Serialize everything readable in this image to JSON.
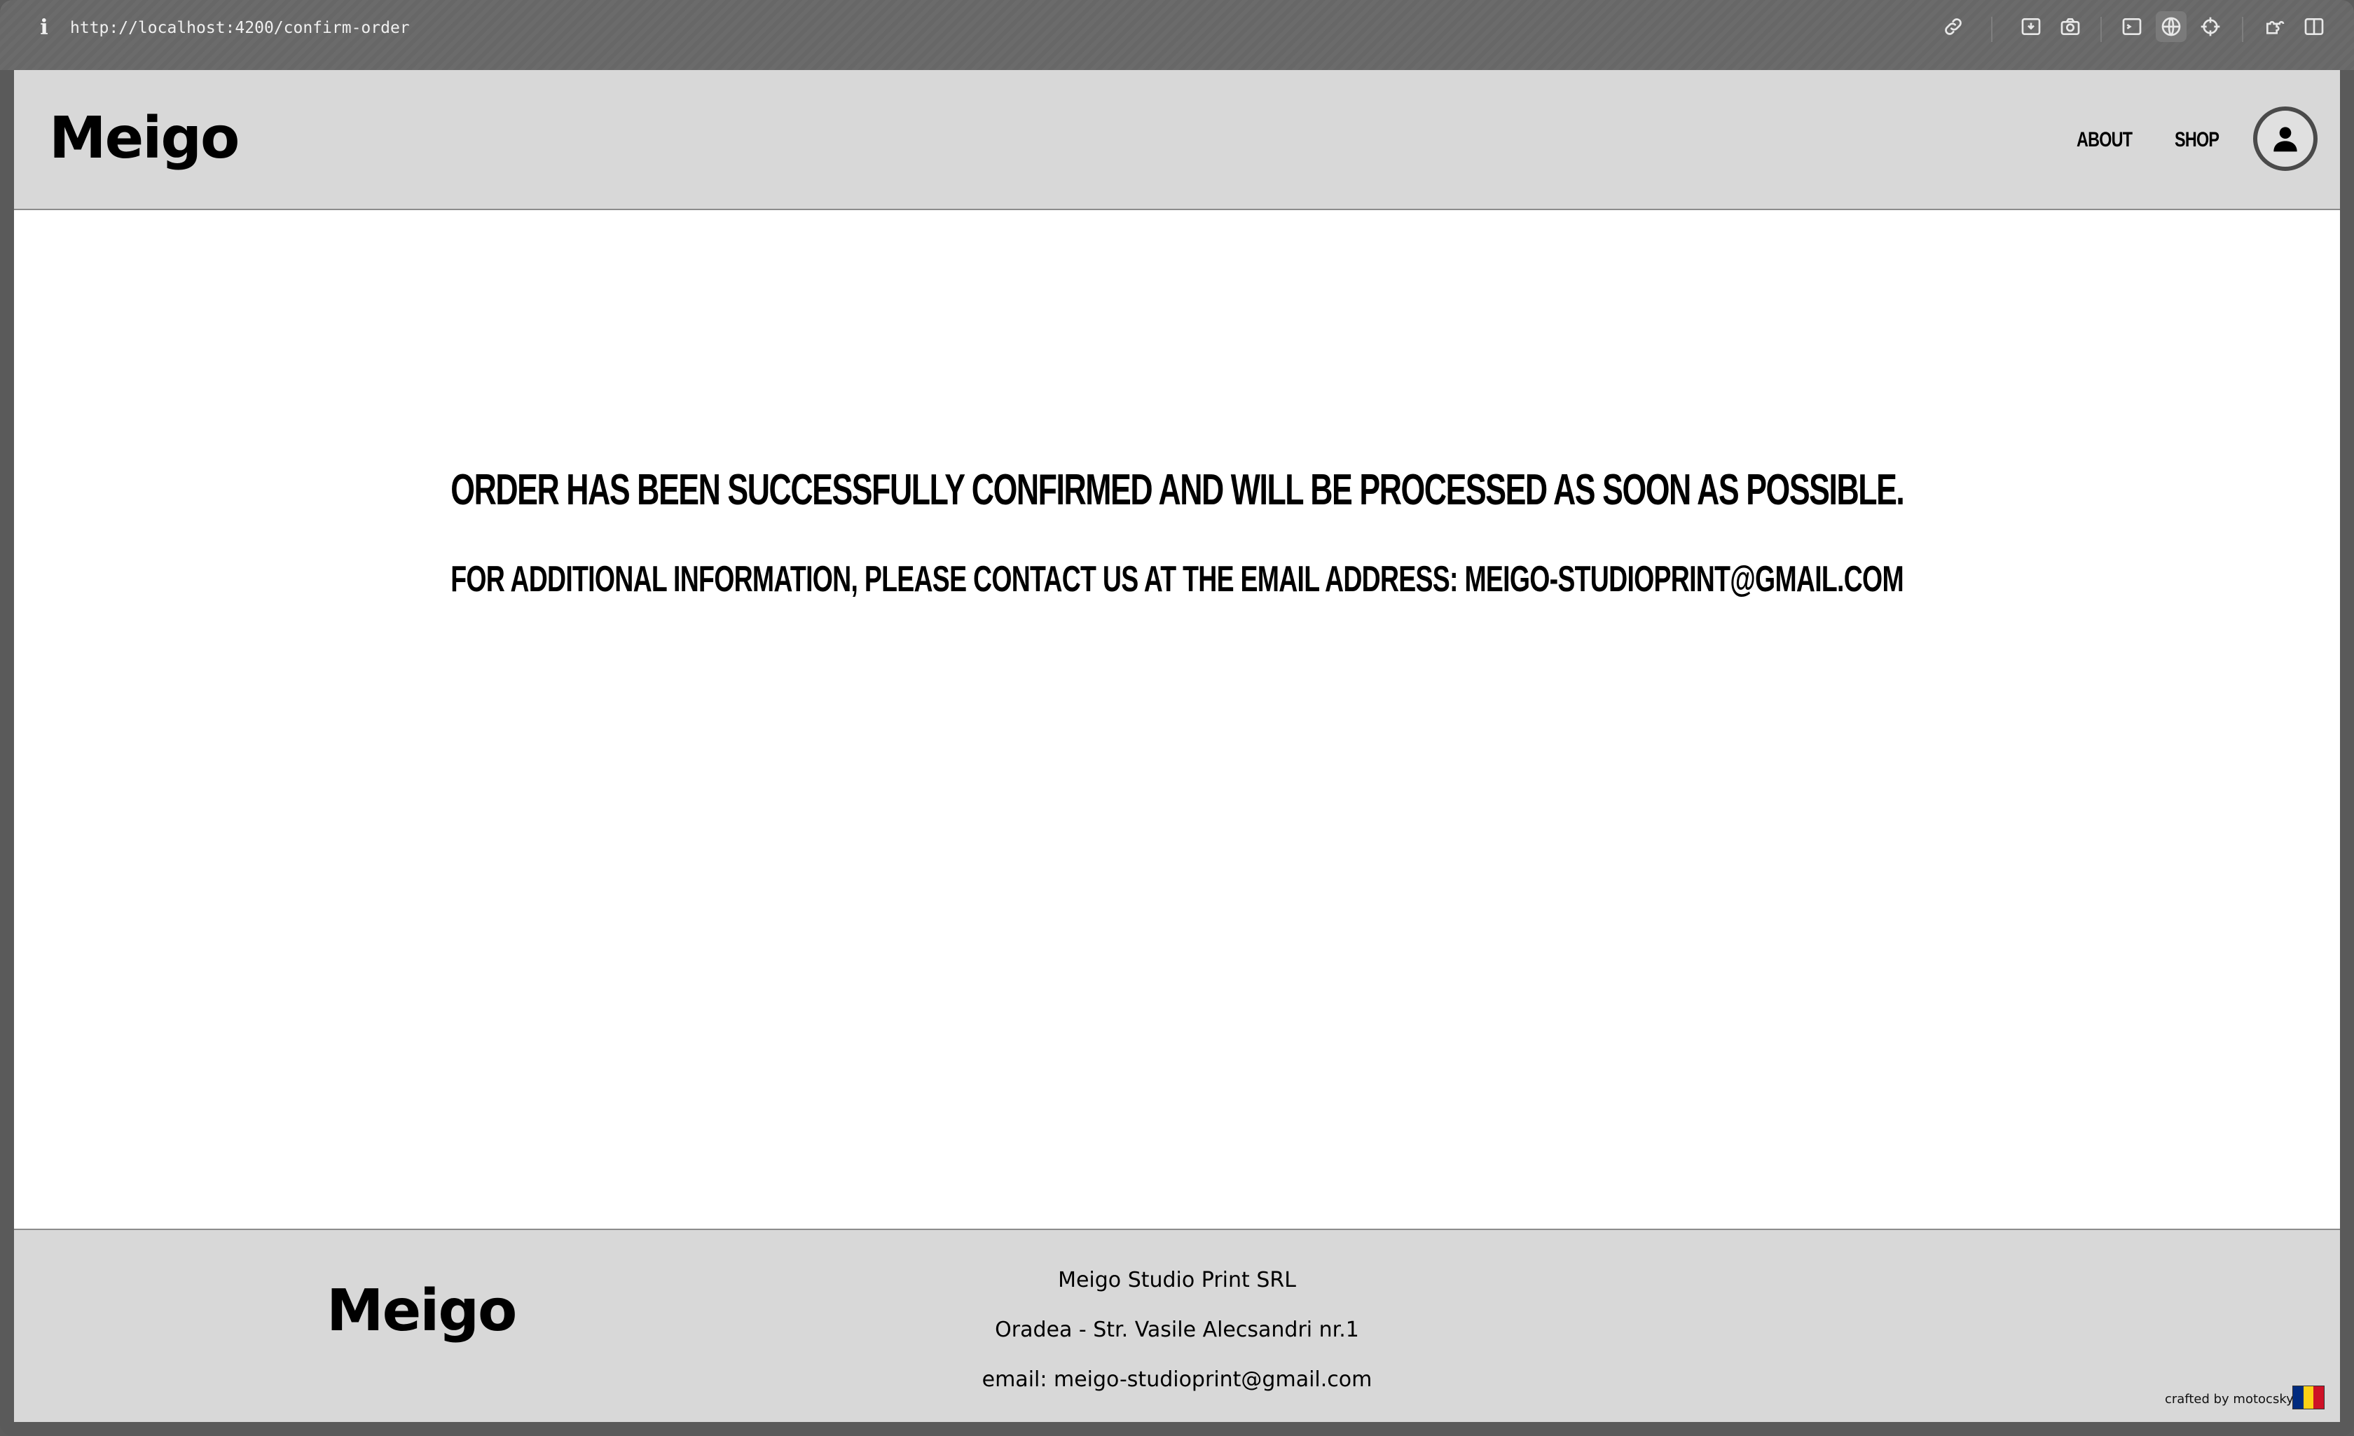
{
  "browser": {
    "url": "http://localhost:4200/confirm-order",
    "info_icon": "i"
  },
  "header": {
    "logo": "Meigo",
    "nav": [
      {
        "label": "ABOUT"
      },
      {
        "label": "SHOP"
      }
    ],
    "account_icon": "user-icon"
  },
  "main": {
    "headline": "ORDER HAS BEEN SUCCESSFULLY CONFIRMED AND WILL BE PROCESSED AS SOON AS POSSIBLE.",
    "subline": "FOR ADDITIONAL INFORMATION, PLEASE CONTACT US AT THE EMAIL ADDRESS: MEIGO-STUDIOPRINT@GMAIL.COM"
  },
  "footer": {
    "logo": "Meigo",
    "company": "Meigo Studio Print SRL",
    "address": "Oradea - Str. Vasile Alecsandri nr.1",
    "email": "email: meigo-studioprint@gmail.com",
    "credit": "crafted by motocsky",
    "flag_colors": [
      "#002b7f",
      "#fcd116",
      "#ce1126"
    ]
  },
  "colors": {
    "header_bg": "#d8d8d8",
    "page_bg": "#ffffff",
    "toolbar_bg": "#676767"
  }
}
